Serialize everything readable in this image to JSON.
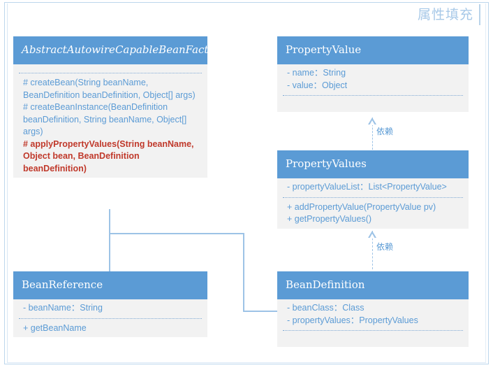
{
  "page": {
    "heading": "属性填充"
  },
  "classes": [
    {
      "id": "abstract-autowire-capable-bean-factory",
      "name": "AbstractAutowireCapableBeanFactory",
      "attributes": [],
      "methods": [
        {
          "text": "# createBean(String beanName, BeanDefinition beanDefinition, Object[] args)",
          "highlight": false
        },
        {
          "text": "# createBeanInstance(BeanDefinition beanDefinition, String beanName, Object[] args)",
          "highlight": false
        },
        {
          "text": "# applyPropertyValues(String beanName, Object bean, BeanDefinition beanDefinition)",
          "highlight": true
        }
      ]
    },
    {
      "id": "property-value",
      "name": "PropertyValue",
      "attributes": [
        {
          "text": "- name：String",
          "highlight": false
        },
        {
          "text": "- value：Object",
          "highlight": false
        }
      ],
      "methods": []
    },
    {
      "id": "property-values",
      "name": "PropertyValues",
      "attributes": [
        {
          "text": "- propertyValueList：List<PropertyValue>",
          "highlight": false
        }
      ],
      "methods": [
        {
          "text": "+ addPropertyValue(PropertyValue pv)",
          "highlight": false
        },
        {
          "text": "+ getPropertyValues()",
          "highlight": false
        }
      ]
    },
    {
      "id": "bean-reference",
      "name": "BeanReference",
      "attributes": [
        {
          "text": "- beanName：String",
          "highlight": false
        }
      ],
      "methods": [
        {
          "text": "+ getBeanName",
          "highlight": false
        }
      ]
    },
    {
      "id": "bean-definition",
      "name": "BeanDefinition",
      "attributes": [
        {
          "text": "- beanClass：Class",
          "highlight": false
        },
        {
          "text": "- propertyValues：PropertyValues",
          "highlight": false
        }
      ],
      "methods": []
    }
  ],
  "relations": [
    {
      "id": "property-values-to-property-value",
      "label": "依赖"
    },
    {
      "id": "bean-definition-to-property-values",
      "label": "依赖"
    }
  ],
  "colors": {
    "header_blue": "#5B9BD5",
    "body_gray": "#F2F2F2",
    "connector_blue": "#9DC3E6",
    "highlight_red": "#C0392B",
    "heading_blue": "#A8C9E8"
  }
}
